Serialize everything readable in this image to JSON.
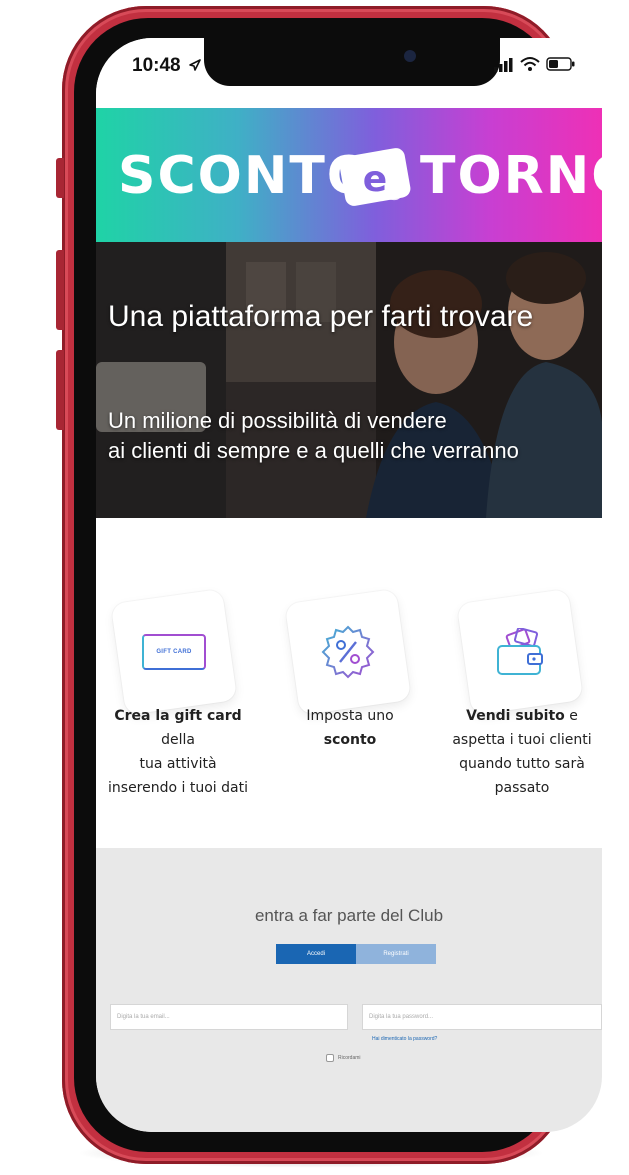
{
  "status_bar": {
    "time": "10:48"
  },
  "brand": {
    "logo_left": "SCONTO",
    "logo_middle": "e",
    "logo_right": "TORNO",
    "gradient_colors": [
      "#1fd3a6",
      "#7f5fdc",
      "#ee30b6"
    ]
  },
  "hero": {
    "title": "Una piattaforma per farti trovare",
    "subtitle_line1": "Un milione di possibilità di vendere",
    "subtitle_line2": "ai clienti di sempre e a quelli che verranno"
  },
  "features": [
    {
      "icon": "gift-card-icon",
      "icon_label": "GIFT CARD",
      "bold": "Crea la gift card",
      "text_after": " della",
      "line2": "tua attività",
      "line3": "inserendo i tuoi dati"
    },
    {
      "icon": "percent-badge-icon",
      "line1": "Imposta uno",
      "bold": "sconto"
    },
    {
      "icon": "wallet-icon",
      "bold": "Vendi subito",
      "text_after": " e",
      "line2": "aspetta i tuoi clienti",
      "line3": "quando tutto sarà",
      "line4": "passato"
    }
  ],
  "club": {
    "title": "entra a far parte del Club",
    "tabs": [
      "Accedi",
      "Registrati"
    ],
    "email_placeholder": "Digita la tua email...",
    "password_placeholder": "Digita la tua password...",
    "forgot_link": "Hai dimenticato la password?",
    "remember_label": "Ricordami"
  },
  "colors": {
    "phone_frame": "#c23040",
    "tab_active": "#1a66b3",
    "tab_inactive": "#8fb3dc",
    "club_background": "#e8e8e8"
  }
}
